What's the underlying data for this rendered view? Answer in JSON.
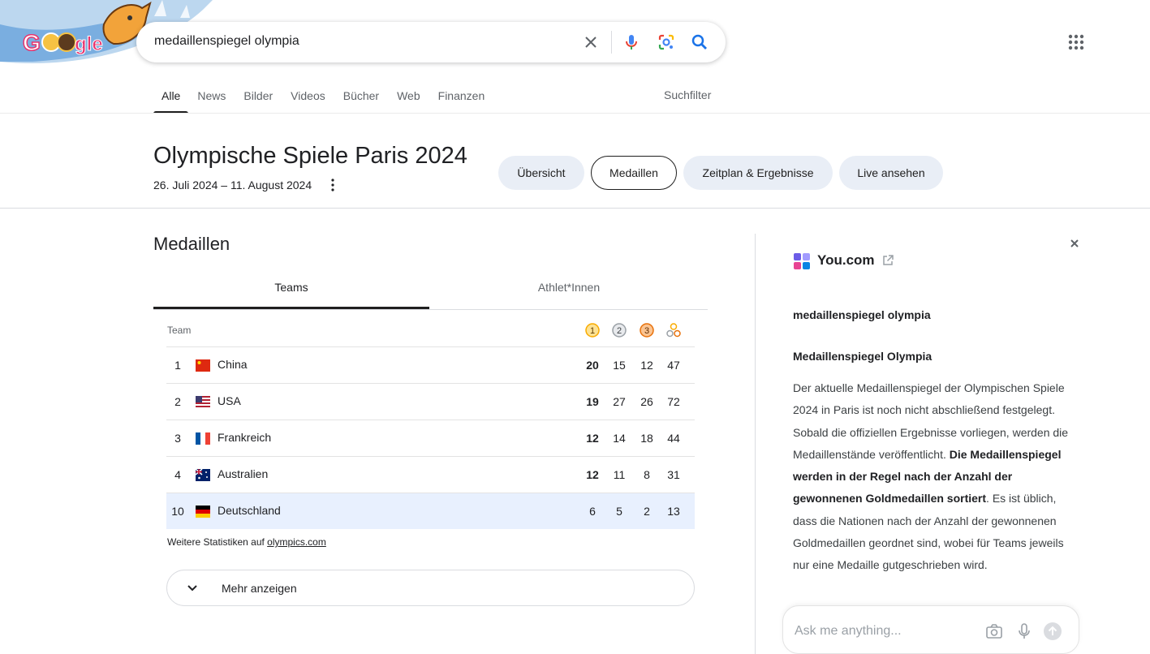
{
  "search": {
    "query": "medaillenspiegel olympia"
  },
  "tabs": [
    "Alle",
    "News",
    "Bilder",
    "Videos",
    "Bücher",
    "Web",
    "Finanzen"
  ],
  "filter_label": "Suchfilter",
  "event": {
    "title": "Olympische Spiele Paris 2024",
    "dates": "26. Juli 2024 – 11. August 2024",
    "pills": [
      "Übersicht",
      "Medaillen",
      "Zeitplan & Ergebnisse",
      "Live ansehen"
    ]
  },
  "medals": {
    "section_title": "Medaillen",
    "tabs": [
      "Teams",
      "Athlet*Innen"
    ],
    "header_team": "Team",
    "medal_icons": {
      "gold": "1",
      "silver": "2",
      "bronze": "3"
    },
    "rows": [
      {
        "rank": "1",
        "country": "China",
        "gold": "20",
        "silver": "15",
        "bronze": "12",
        "total": "47"
      },
      {
        "rank": "2",
        "country": "USA",
        "gold": "19",
        "silver": "27",
        "bronze": "26",
        "total": "72"
      },
      {
        "rank": "3",
        "country": "Frankreich",
        "gold": "12",
        "silver": "14",
        "bronze": "18",
        "total": "44"
      },
      {
        "rank": "4",
        "country": "Australien",
        "gold": "12",
        "silver": "11",
        "bronze": "8",
        "total": "31"
      },
      {
        "rank": "10",
        "country": "Deutschland",
        "gold": "6",
        "silver": "5",
        "bronze": "2",
        "total": "13"
      }
    ],
    "stats_prefix": "Weitere Statistiken auf ",
    "stats_link": "olympics.com",
    "more_label": "Mehr anzeigen"
  },
  "panel": {
    "source": "You.com",
    "query": "medaillenspiegel olympia",
    "heading": "Medaillenspiegel Olympia",
    "p1": "Der aktuelle Medaillenspiegel der Olympischen Spiele 2024 in Paris ist noch nicht abschließend festgelegt. Sobald die offiziellen Ergebnisse vorliegen, werden die Medaillenstände veröffentlicht. ",
    "p2_bold": "Die Medaillenspiegel werden in der Regel nach der Anzahl der gewonnenen Goldmedaillen sortiert",
    "p3": ". Es ist üblich, dass die Nationen nach der Anzahl der gewonnenen Goldmedaillen geordnet sind, wobei für Teams jeweils nur eine Medaille gutgeschrieben wird.",
    "ask_placeholder": "Ask me anything..."
  },
  "colors": {
    "gold": "#f9ab00",
    "silver": "#9aa0a6",
    "bronze": "#e8710a",
    "google_blue": "#1a73e8"
  }
}
